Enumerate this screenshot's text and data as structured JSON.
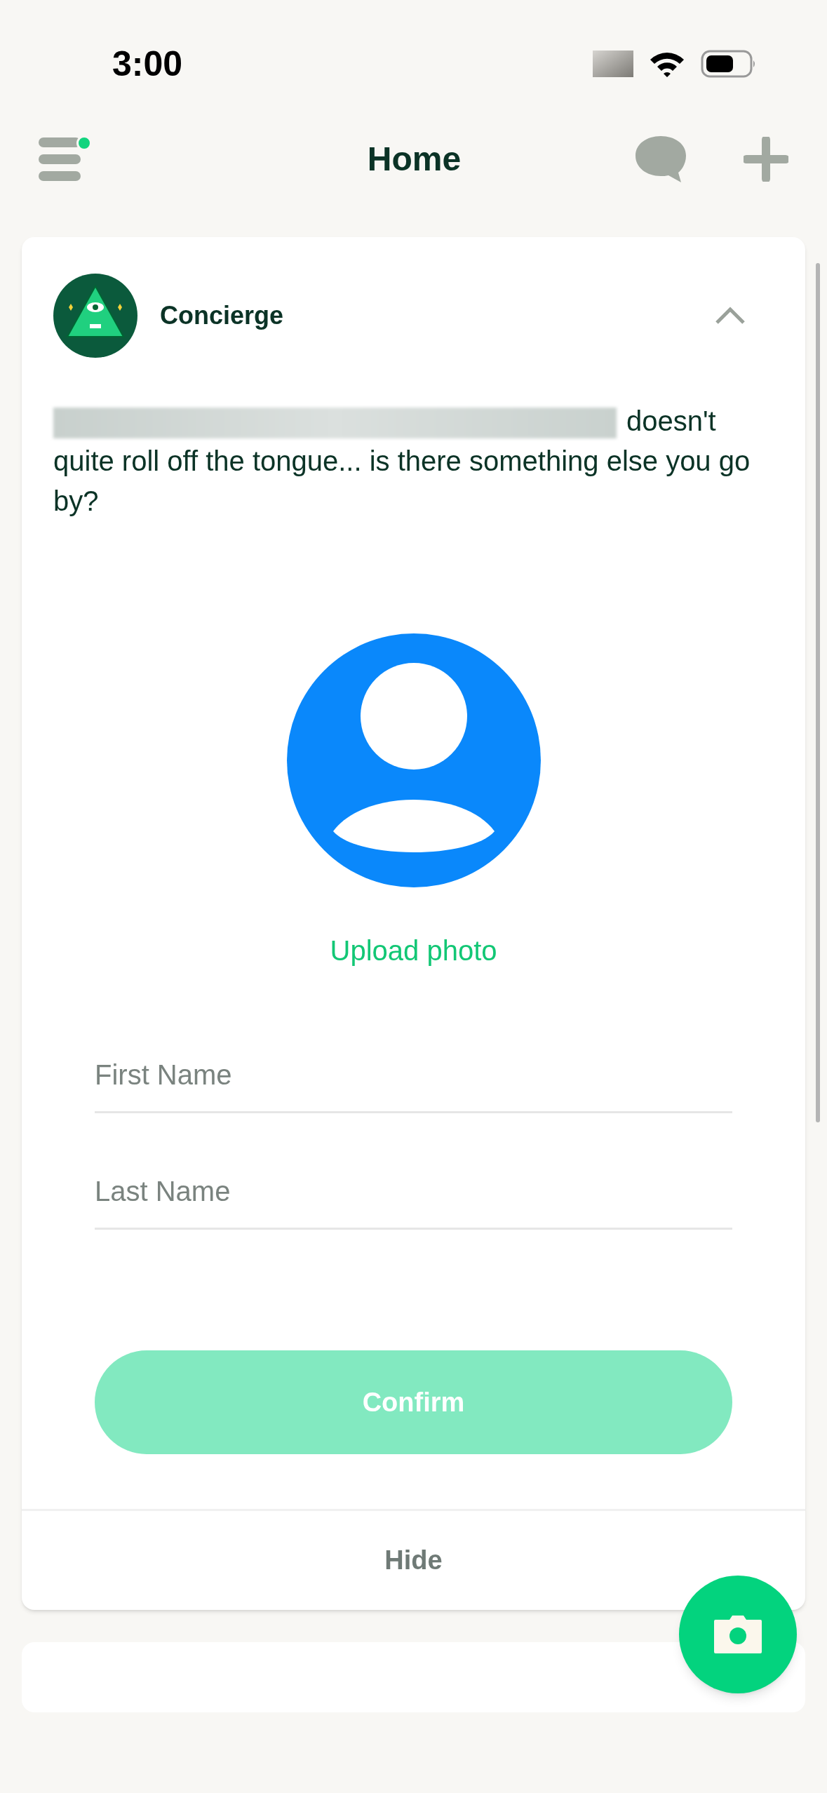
{
  "status_bar": {
    "time": "3:00"
  },
  "nav": {
    "title": "Home",
    "menu_badge": true
  },
  "card": {
    "sender": "Concierge",
    "expanded": true,
    "message": "doesn't quite roll off the tongue... is there something else you go by?",
    "upload_label": "Upload photo",
    "fields": [
      {
        "placeholder": "First Name"
      },
      {
        "placeholder": "Last Name"
      }
    ],
    "confirm": {
      "label": "Confirm",
      "disabled": true
    },
    "hide_label": "Hide"
  }
}
